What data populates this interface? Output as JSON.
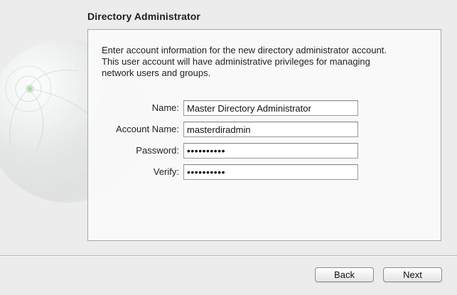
{
  "header": {
    "title": "Directory Administrator"
  },
  "description": {
    "line1": "Enter account information for the new directory administrator account.",
    "line2": "This user account will have administrative privileges for managing",
    "line3": "network users and groups."
  },
  "form": {
    "name_label": "Name:",
    "name_value": "Master Directory Administrator",
    "account_name_label": "Account Name:",
    "account_name_value": "masterdiradmin",
    "password_label": "Password:",
    "password_value": "••••••••••",
    "verify_label": "Verify:",
    "verify_value": "••••••••••"
  },
  "buttons": {
    "back_label": "Back",
    "next_label": "Next"
  },
  "icons": {
    "background": "globe-icon"
  }
}
